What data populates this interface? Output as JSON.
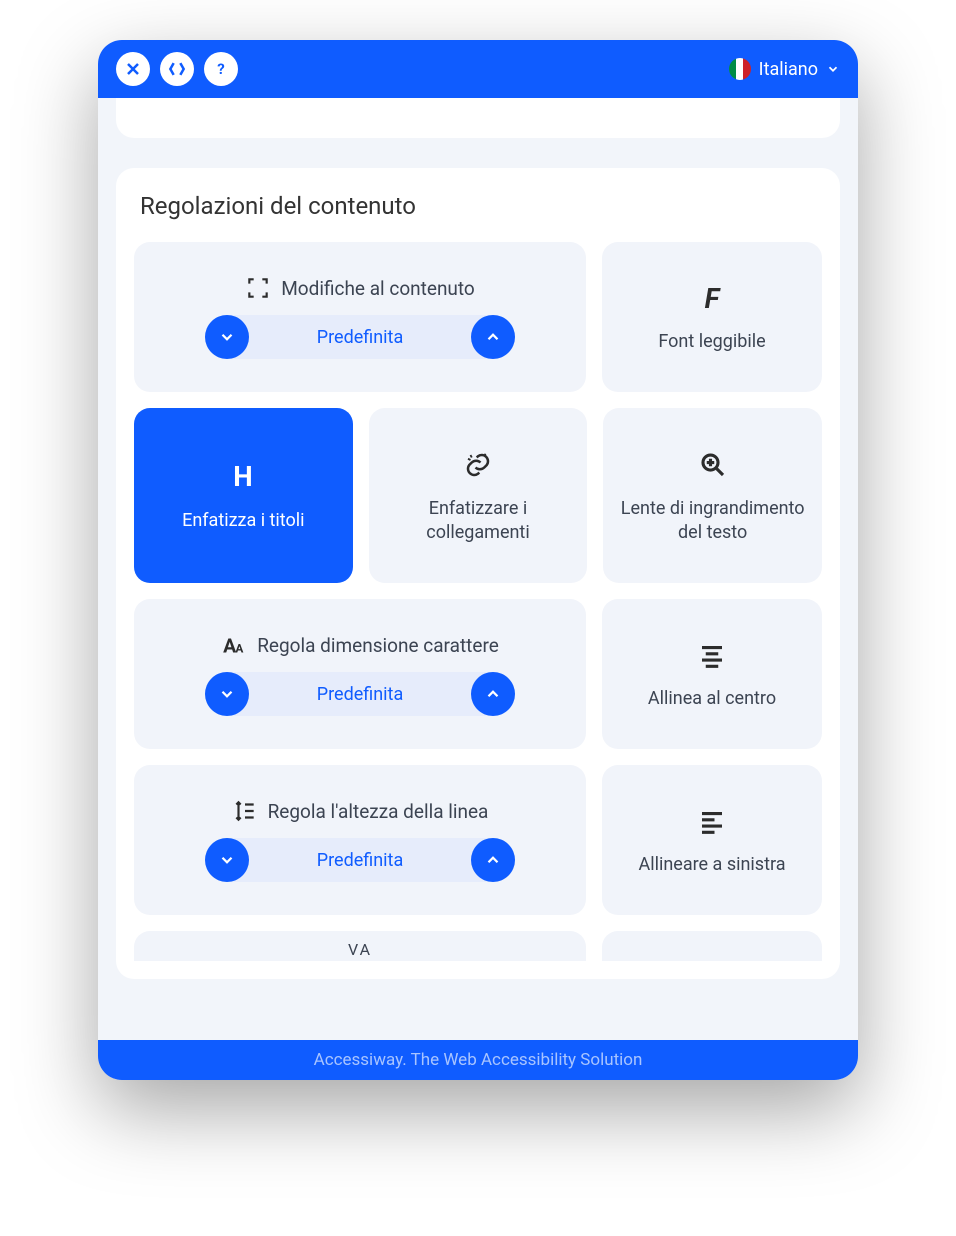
{
  "header": {
    "language": "Italiano"
  },
  "panel": {
    "title": "Regolazioni del contenuto"
  },
  "steppers": {
    "content_scale": {
      "title": "Modifiche al contenuto",
      "value": "Predefinita"
    },
    "font_size": {
      "title": "Regola dimensione carattere",
      "value": "Predefinita"
    },
    "line_height": {
      "title": "Regola l'altezza della linea",
      "value": "Predefinita"
    }
  },
  "cards": {
    "readable_font": "Font leggibile",
    "highlight_titles": "Enfatizza i titoli",
    "highlight_links": "Enfatizzare i collegamenti",
    "text_magnifier": "Lente di ingrandimento del testo",
    "align_center": "Allinea al centro",
    "align_left": "Allineare a sinistra"
  },
  "partial": {
    "letter_spacing_hint": "VA"
  },
  "footer": {
    "text": "Accessiway. The Web Accessibility Solution"
  }
}
